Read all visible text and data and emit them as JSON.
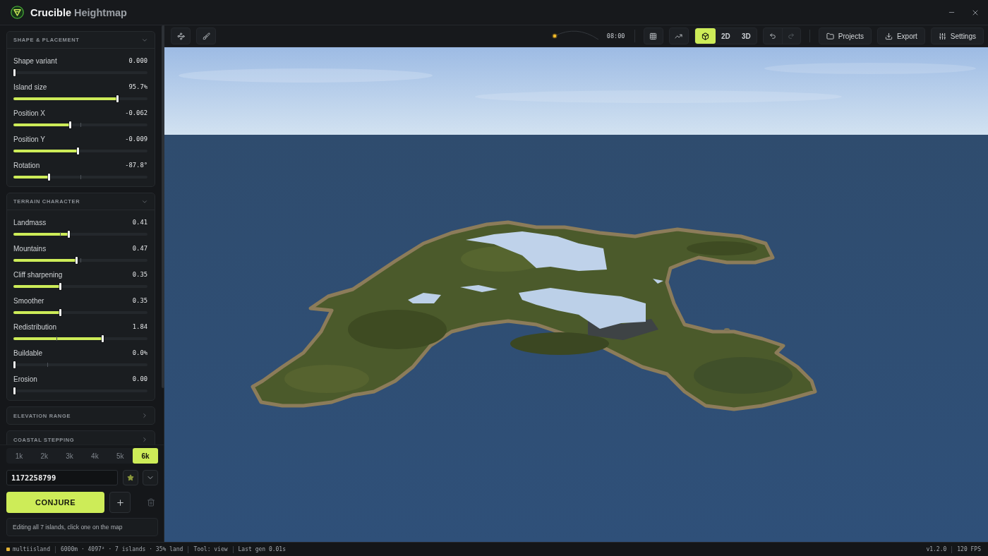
{
  "app": {
    "title": "Crucible",
    "subtitle": "Heightmap"
  },
  "sidebar": {
    "sections": [
      {
        "title": "SHAPE & PLACEMENT",
        "expanded": true,
        "sliders": [
          {
            "label": "Shape variant",
            "value": "0.000",
            "level": 0
          },
          {
            "label": "Island size",
            "value": "95.7%",
            "level": 0.78
          },
          {
            "label": "Position X",
            "value": "-0.062",
            "level": 0.42,
            "default": {
              "level": 0.5
            }
          },
          {
            "label": "Position Y",
            "value": "-0.009",
            "level": 0.48
          },
          {
            "label": "Rotation",
            "value": "-87.8°",
            "level": 0.26,
            "default": {
              "level": 0.5
            }
          }
        ]
      },
      {
        "title": "TERRAIN CHARACTER",
        "expanded": true,
        "sliders": [
          {
            "label": "Landmass",
            "value": "0.41",
            "level": 0.41,
            "default": {
              "level": 0.35
            }
          },
          {
            "label": "Mountains",
            "value": "0.47",
            "level": 0.47,
            "default": {
              "level": 0.5
            }
          },
          {
            "label": "Cliff sharpening",
            "value": "0.35",
            "level": 0.35
          },
          {
            "label": "Smoother",
            "value": "0.35",
            "level": 0.35
          },
          {
            "label": "Redistribution",
            "value": "1.84",
            "level": 0.67,
            "default": {
              "level": 0.32
            }
          },
          {
            "label": "Buildable",
            "value": "0.0%",
            "level": 0,
            "default": {
              "level": 0.25
            }
          },
          {
            "label": "Erosion",
            "value": "0.00",
            "level": 0
          }
        ]
      },
      {
        "title": "ELEVATION RANGE",
        "expanded": false
      },
      {
        "title": "COASTAL STEPPING",
        "expanded": false
      }
    ],
    "resolutions": [
      {
        "label": "1k",
        "selected": false
      },
      {
        "label": "2k",
        "selected": false
      },
      {
        "label": "3k",
        "selected": false
      },
      {
        "label": "4k",
        "selected": false
      },
      {
        "label": "5k",
        "selected": false
      },
      {
        "label": "6k",
        "selected": true
      }
    ],
    "seed": {
      "value": "1172258799"
    },
    "generate_button": "CONJURE",
    "hint": "Editing all 7 islands, click one on the map"
  },
  "toolbar": {
    "time": {
      "label": "08:00",
      "level": 0
    },
    "view_modes": [
      {
        "kind": "cube",
        "selected": true
      },
      {
        "kind": "text",
        "label": "2D",
        "selected": false
      },
      {
        "kind": "text",
        "label": "3D",
        "selected": false
      }
    ],
    "undo": {
      "disabled": false
    },
    "redo": {
      "disabled": true
    },
    "actions": [
      {
        "kind": "folder",
        "label": "Projects"
      },
      {
        "kind": "download",
        "label": "Export"
      },
      {
        "kind": "sliders",
        "label": "Settings"
      }
    ]
  },
  "status_bar": {
    "mode": "multiisland",
    "items": [
      "6000m · 4097² · 7 islands · 35% land",
      "Tool: view",
      "Last gen 0.01s"
    ],
    "right": [
      "v1.2.0",
      "120 FPS"
    ]
  }
}
